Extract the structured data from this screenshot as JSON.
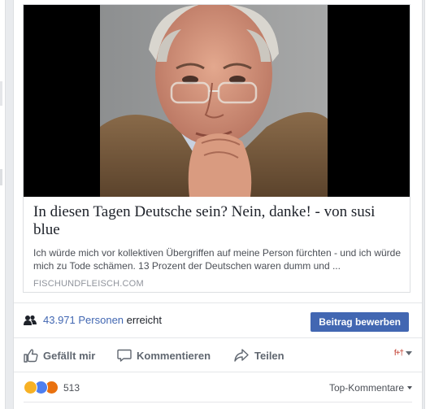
{
  "link_preview": {
    "title": "In diesen Tagen Deutsche sein? Nein, danke! - von susi blue",
    "description": "Ich würde mich vor kollektiven Übergriffen auf meine Person fürchten - und ich würde mich zu Tode schämen. 13 Prozent der Deutschen waren dumm und ...",
    "domain": "FISCHUNDFLEISCH.COM"
  },
  "reach": {
    "count": "43.971 Personen",
    "suffix": "erreicht",
    "promote_label": "Beitrag bewerben"
  },
  "actions": {
    "like": "Gefällt mir",
    "comment": "Kommentieren",
    "share": "Teilen",
    "audience_icon": "f+†"
  },
  "reactions": {
    "count": "513",
    "icons": [
      "haha-reaction-icon",
      "like-reaction-icon",
      "angry-reaction-icon"
    ],
    "sort_label": "Top-Kommentare"
  },
  "colors": {
    "accent": "#4267b2",
    "link": "#4267b2",
    "text": "#1d2129",
    "muted": "#90949c"
  }
}
